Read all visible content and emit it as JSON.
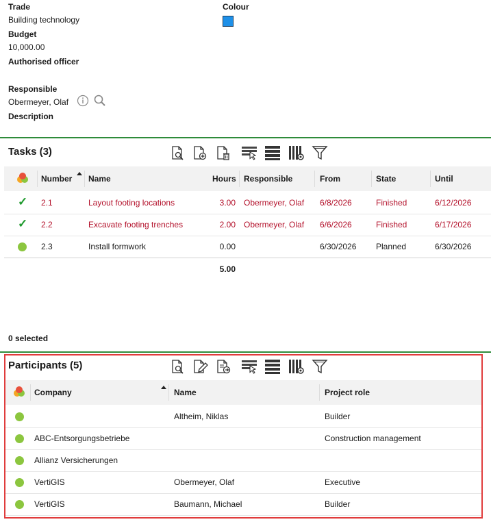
{
  "form": {
    "trade_label": "Trade",
    "trade_value": "Building technology",
    "colour_label": "Colour",
    "colour_value": "#1e90e8",
    "budget_label": "Budget",
    "budget_value": "10,000.00",
    "authorised_officer_label": "Authorised officer",
    "responsible_label": "Responsible",
    "responsible_value": "Obermeyer, Olaf",
    "description_label": "Description"
  },
  "tasks": {
    "title": "Tasks (3)",
    "toolbar_icons": [
      "view-icon",
      "add-icon",
      "delete-icon",
      "select-icon",
      "list-icon",
      "columns-settings-icon",
      "filter-icon"
    ],
    "columns": [
      "Number",
      "Name",
      "Hours",
      "Responsible",
      "From",
      "State",
      "Until"
    ],
    "rows": [
      {
        "status": "check",
        "number": "2.1",
        "name": "Layout footing locations",
        "hours": "3.00",
        "responsible": "Obermeyer, Olaf",
        "from": "6/8/2026",
        "state": "Finished",
        "until": "6/12/2026",
        "color": "red"
      },
      {
        "status": "check",
        "number": "2.2",
        "name": "Excavate footing trenches",
        "hours": "2.00",
        "responsible": "Obermeyer, Olaf",
        "from": "6/6/2026",
        "state": "Finished",
        "until": "6/17/2026",
        "color": "red"
      },
      {
        "status": "dot",
        "number": "2.3",
        "name": "Install formwork",
        "hours": "0.00",
        "responsible": "",
        "from": "6/30/2026",
        "state": "Planned",
        "until": "6/30/2026",
        "color": "normal"
      }
    ],
    "total_hours": "5.00",
    "selected_text": "0 selected"
  },
  "participants": {
    "title": "Participants (5)",
    "toolbar_icons": [
      "view-icon",
      "edit-icon",
      "export-icon",
      "select-icon",
      "list-icon",
      "columns-settings-icon",
      "filter-icon"
    ],
    "columns": [
      "Company",
      "Name",
      "Project role"
    ],
    "rows": [
      {
        "company": "",
        "name": "Altheim, Niklas",
        "role": "Builder"
      },
      {
        "company": "ABC-Entsorgungsbetriebe",
        "name": "",
        "role": "Construction management"
      },
      {
        "company": "Allianz Versicherungen",
        "name": "",
        "role": ""
      },
      {
        "company": "VertiGIS",
        "name": "Obermeyer, Olaf",
        "role": "Executive"
      },
      {
        "company": "VertiGIS",
        "name": "Baumann, Michael",
        "role": "Builder"
      }
    ],
    "highlight_color": "#e03c3c"
  }
}
